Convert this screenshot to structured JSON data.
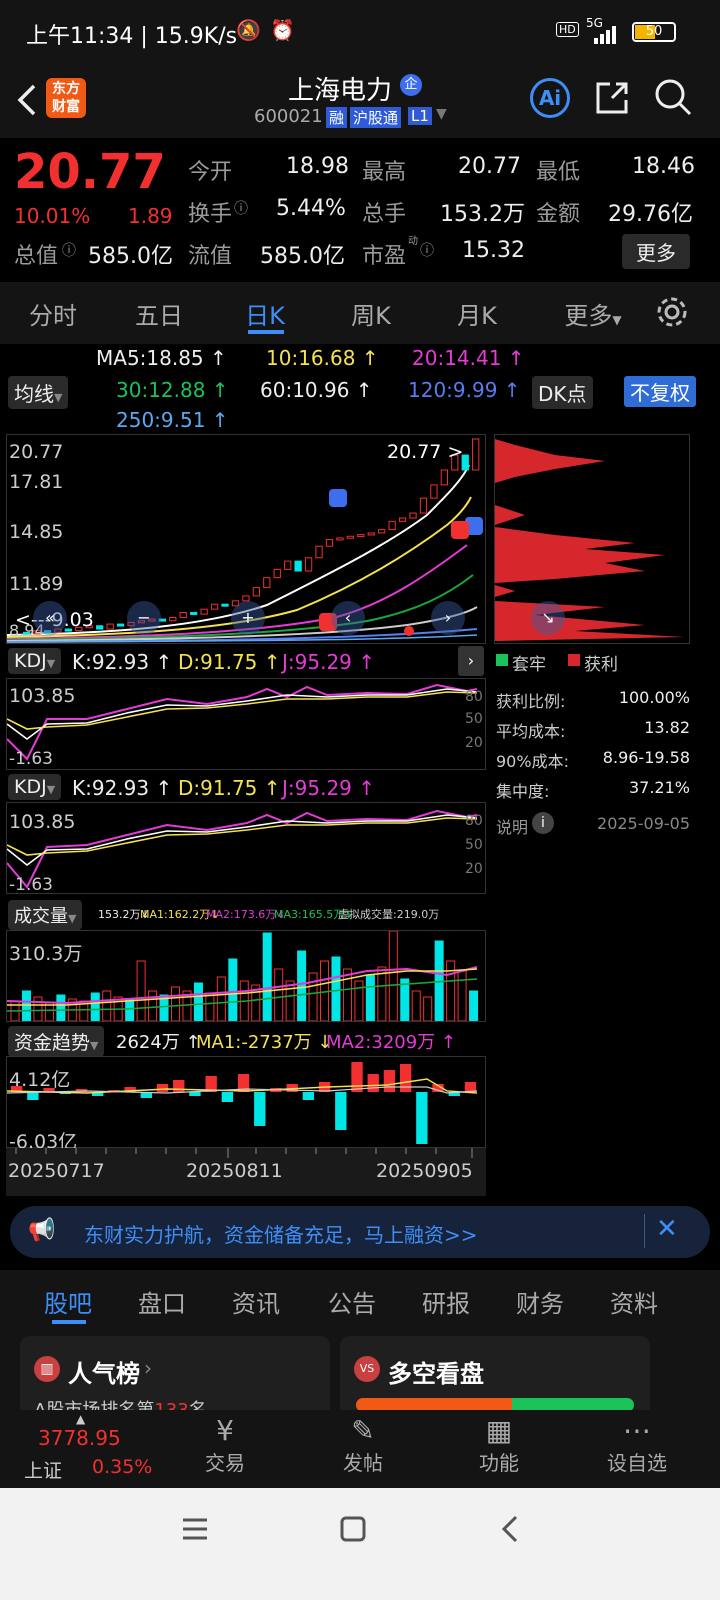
{
  "status": {
    "time": "上午11:34 | 15.9K/s",
    "network": "5G",
    "battery": "50"
  },
  "header": {
    "logo_line1": "东方",
    "logo_line2": "财富",
    "title": "上海电力",
    "badge": "企",
    "code": "600021",
    "tag1": "融",
    "tag2": "沪股通",
    "tag3": "L1",
    "ai": "Ai"
  },
  "quote": {
    "price": "20.77",
    "pct": "10.01%",
    "chg": "1.89",
    "open_lbl": "今开",
    "open": "18.98",
    "high_lbl": "最高",
    "high": "20.77",
    "low_lbl": "最低",
    "low": "18.46",
    "turn_lbl": "换手",
    "turn": "5.44%",
    "vol_lbl": "总手",
    "vol": "153.2万",
    "amt_lbl": "金额",
    "amt": "29.76亿",
    "mcap_lbl": "总值",
    "mcap": "585.0亿",
    "float_lbl": "流值",
    "float": "585.0亿",
    "pe_lbl": "市盈",
    "pe_sup": "动",
    "pe": "15.32",
    "more": "更多"
  },
  "tabs": [
    "分时",
    "五日",
    "日K",
    "周K",
    "月K",
    "更多"
  ],
  "ma": {
    "selector": "均线",
    "ma5": "MA5:18.85 ↑",
    "ma10": "10:16.68 ↑",
    "ma20": "20:14.41 ↑",
    "ma30": "30:12.88 ↑",
    "ma60": "60:10.96 ↑",
    "ma120": "120:9.99 ↑",
    "ma250": "250:9.51 ↑",
    "dk": "DK点",
    "fq": "不复权"
  },
  "kline": {
    "y1": "20.77",
    "y2": "17.81",
    "y3": "14.85",
    "y4": "11.89",
    "y5": "8.94",
    "last": "20.77",
    "low_mark": "9.03"
  },
  "kline_data": {
    "closes": [
      9.1,
      9.0,
      9.2,
      9.1,
      9.3,
      9.2,
      9.4,
      9.5,
      9.3,
      9.6,
      9.5,
      9.7,
      9.8,
      9.9,
      9.8,
      10.0,
      10.3,
      10.2,
      10.5,
      10.8,
      10.7,
      11.0,
      11.3,
      11.8,
      12.4,
      12.9,
      13.4,
      12.8,
      13.6,
      14.3,
      14.7,
      14.8,
      14.9,
      15.0,
      15.1,
      15.3,
      15.8,
      16.0,
      16.3,
      17.2,
      18.0,
      18.9,
      19.8,
      18.9,
      20.77
    ]
  },
  "chip": {
    "legend_trapped": "套牢",
    "legend_profit": "获利",
    "r1_lbl": "获利比例:",
    "r1": "100.00%",
    "r2_lbl": "平均成本:",
    "r2": "13.82",
    "r3_lbl": "90%成本:",
    "r3": "8.96-19.58",
    "r4_lbl": "集中度:",
    "r4": "37.21%",
    "note_lbl": "说明",
    "date": "2025-09-05"
  },
  "kdj1": {
    "name": "KDJ",
    "k": "K:92.93 ↑",
    "d": "D:91.75 ↑",
    "j": "J:95.29 ↑",
    "top": "103.85",
    "bottom": "-1.63",
    "l80": "80",
    "l50": "50",
    "l20": "20"
  },
  "kdj2": {
    "name": "KDJ",
    "k": "K:92.93 ↑",
    "d": "D:91.75 ↑",
    "j": "J:95.29 ↑",
    "top": "103.85",
    "bottom": "-1.63",
    "l80": "80",
    "l50": "50",
    "l20": "20"
  },
  "volume": {
    "name": "成交量",
    "v": "153.2万↓",
    "ma1": "MA1:162.2万↓",
    "ma2": "MA2:173.6万↓",
    "ma3": "MA3:165.5万↓",
    "virt": "虚拟成交量:219.0万",
    "top": "310.3万"
  },
  "fund": {
    "name": "资金趋势",
    "v": "2624万 ↑",
    "ma1": "MA1:-2737万 ↓",
    "ma2": "MA2:3209万 ↑",
    "top": "4.12亿",
    "bottom": "-6.03亿"
  },
  "dates": [
    "20250717",
    "20250811",
    "20250905"
  ],
  "banner": {
    "text": "东财实力护航，资金储备充足，马上融资>>"
  },
  "sectabs": [
    "股吧",
    "盘口",
    "资讯",
    "公告",
    "研报",
    "财务",
    "资料"
  ],
  "cards": {
    "c1_title": "人气榜",
    "c1_sub_pre": "A股市场排名第",
    "c1_rank": "133",
    "c1_sub_post": "名",
    "c2_title": "多空看盘"
  },
  "bottomnav": {
    "index_val": "3778.95",
    "index_name": "上证",
    "index_pct": "0.35%",
    "items": [
      "交易",
      "发帖",
      "功能",
      "设自选"
    ]
  },
  "colors": {
    "up": "#f23030",
    "down": "#00e5e5",
    "accent": "#3e8ef7"
  }
}
